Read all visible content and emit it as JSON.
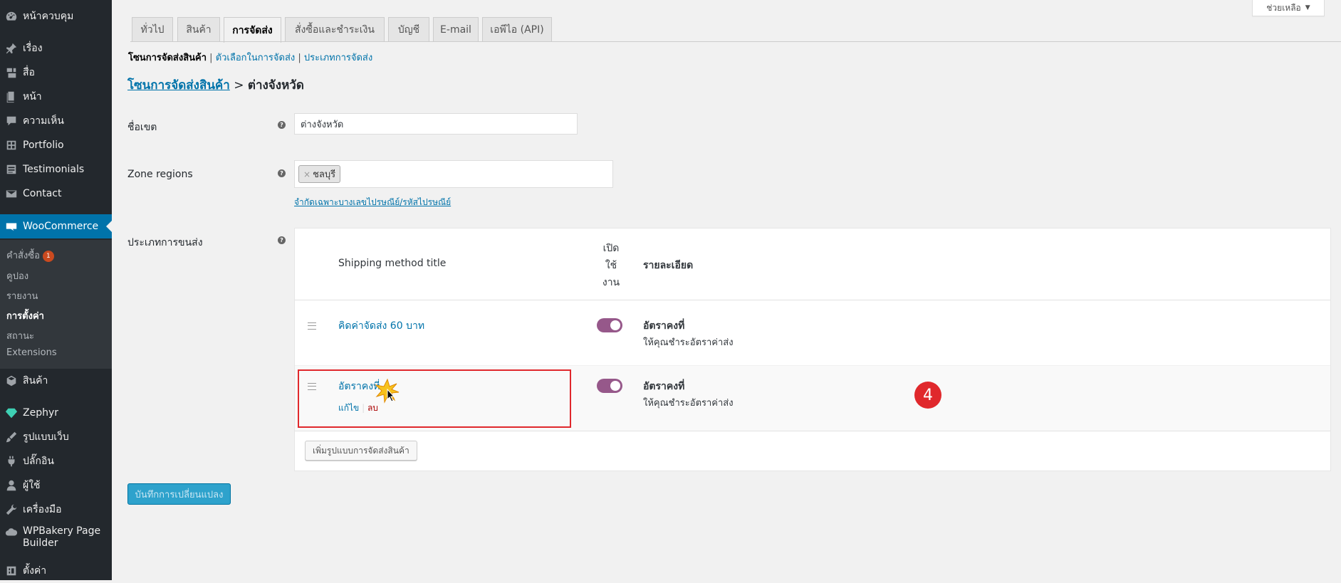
{
  "sidebar": {
    "items": [
      {
        "label": "หน้าควบคุม",
        "icon": "dashboard-icon"
      },
      {
        "label": "เรื่อง",
        "icon": "pin-icon"
      },
      {
        "label": "สื่อ",
        "icon": "media-icon"
      },
      {
        "label": "หน้า",
        "icon": "page-icon"
      },
      {
        "label": "ความเห็น",
        "icon": "comment-icon"
      },
      {
        "label": "Portfolio",
        "icon": "portfolio-icon"
      },
      {
        "label": "Testimonials",
        "icon": "testimonial-icon"
      },
      {
        "label": "Contact",
        "icon": "mail-icon"
      },
      {
        "label": "WooCommerce",
        "icon": "woo-icon"
      },
      {
        "label": "สินค้า",
        "icon": "box-icon"
      },
      {
        "label": "Zephyr",
        "icon": "gem-icon"
      },
      {
        "label": "รูปแบบเว็บ",
        "icon": "brush-icon"
      },
      {
        "label": "ปลั๊กอิน",
        "icon": "plugin-icon"
      },
      {
        "label": "ผู้ใช้",
        "icon": "user-icon"
      },
      {
        "label": "เครื่องมือ",
        "icon": "wrench-icon"
      },
      {
        "label": "WPBakery Page Builder",
        "icon": "cloud-icon"
      },
      {
        "label": "ตั้งค่า",
        "icon": "settings-icon"
      }
    ],
    "submenu": [
      {
        "label": "คำสั่งซื้อ",
        "badge": "1"
      },
      {
        "label": "คูปอง"
      },
      {
        "label": "รายงาน"
      },
      {
        "label": "การตั้งค่า"
      },
      {
        "label": "สถานะ"
      },
      {
        "label": "Extensions"
      }
    ]
  },
  "help_label": "ช่วยเหลือ",
  "tabs": [
    "ทั่วไป",
    "สินค้า",
    "การจัดส่ง",
    "สั่งซื้อและชำระเงิน",
    "บัญชี",
    "E-mail",
    "เอพีไอ (API)"
  ],
  "subsub": {
    "current": "โซนการจัดส่งสินค้า",
    "links": [
      "ตัวเลือกในการจัดส่ง",
      "ประเภทการจัดส่ง"
    ],
    "separator": "|"
  },
  "heading": {
    "link": "โซนการจัดส่งสินค้า",
    "separator": ">",
    "current": "ต่างจังหวัด"
  },
  "form": {
    "zone_name_label": "ชื่อเขต",
    "zone_name_value": "ต่างจังหวัด",
    "zone_regions_label": "Zone regions",
    "region_chip": "ชลบุรี",
    "region_chip_remove": "×",
    "limit_link": "จำกัดเฉพาะบางเลขไปรษณีย์/รหัสไปรษณีย์",
    "shipping_methods_label": "ประเภทการขนส่ง",
    "help_tip": "?"
  },
  "table": {
    "col_title": "Shipping method title",
    "col_enabled": [
      "เปิด",
      "ใช้",
      "งาน"
    ],
    "col_description": "รายละเอียด",
    "rows": [
      {
        "title": "คิดค่าจัดส่ง 60 บาท",
        "enabled": true,
        "desc_title": "อัตราคงที่",
        "desc_sub": "ให้คุณชำระอัตราค่าส่ง"
      },
      {
        "title": "อัตราคงที่",
        "enabled": true,
        "desc_title": "อัตราคงที่",
        "desc_sub": "ให้คุณชำระอัตราค่าส่ง",
        "edit": "แก้ไข",
        "delete": "ลบ"
      }
    ],
    "add_button": "เพิ่มรูปแบบการจัดส่งสินค้า"
  },
  "step_badge": "4",
  "save_button": "บันทึกการเปลี่ยนแปลง",
  "colors": {
    "accent": "#0073aa",
    "toggle": "#96588a",
    "highlight": "#e0282c",
    "save": "#2ea2cc"
  }
}
